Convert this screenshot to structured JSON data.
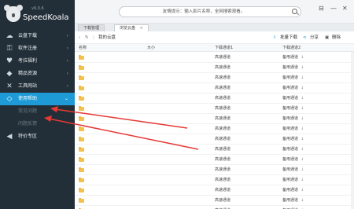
{
  "app": {
    "version": "v0.0.6",
    "name": "SpeedKoala"
  },
  "sidebar": {
    "items": [
      {
        "label": "云盘下载",
        "icon": "cloud-icon"
      },
      {
        "label": "软件注册",
        "icon": "key-icon"
      },
      {
        "label": "考拉福利",
        "icon": "heart-icon"
      },
      {
        "label": "精品资源",
        "icon": "gem-icon"
      },
      {
        "label": "工具网站",
        "icon": "tools-icon"
      },
      {
        "label": "使用帮助",
        "icon": "help-icon",
        "active": true
      },
      {
        "label": "常见问题",
        "sub": true
      },
      {
        "label": "问题反馈",
        "sub": true
      },
      {
        "label": "特价专区",
        "icon": "megaphone-icon"
      }
    ]
  },
  "topbar": {
    "search_text": "友情提示：输入影片名称，全网搜索观看。"
  },
  "tabs": [
    {
      "label": "下载管理"
    },
    {
      "label": "浏览云盘",
      "active": true,
      "close": "×"
    }
  ],
  "toolbar": {
    "my_disk": "我的云盘",
    "batch_download": "批量下载",
    "share": "分享",
    "delete": "删除"
  },
  "table": {
    "columns": [
      "名称",
      "大小",
      "下载通道1",
      "下载通道2"
    ],
    "channel1_label": "高速通道",
    "channel2_label": "备用通道",
    "rows": 16
  },
  "colors": {
    "sidebar_bg": "#232f38",
    "active_bg": "#1e9ad6",
    "arrow": "#e53935",
    "folder": "#f2c14e"
  }
}
